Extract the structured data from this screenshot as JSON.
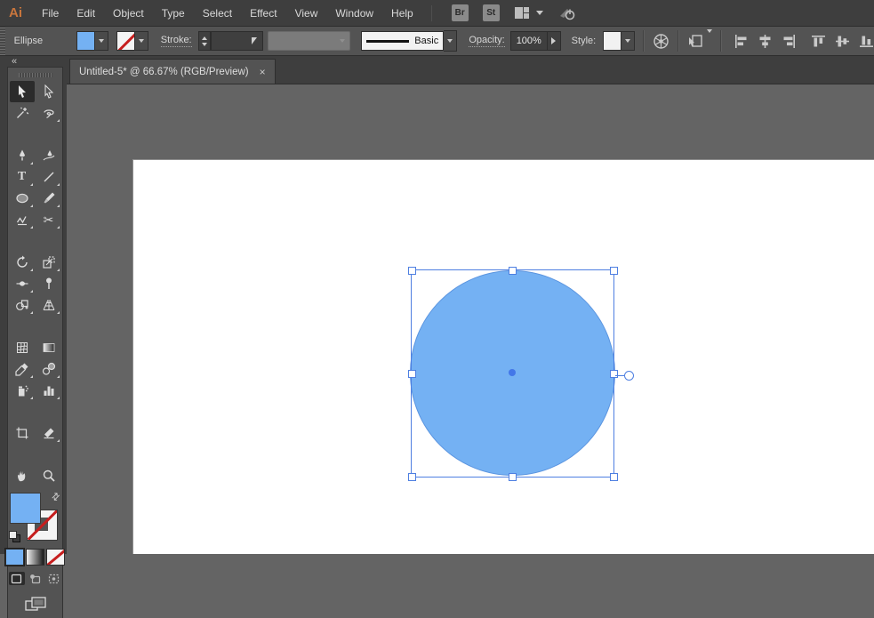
{
  "app": {
    "logo": "Ai",
    "accent_orange": "#C9763D"
  },
  "menubar": {
    "items": [
      "File",
      "Edit",
      "Object",
      "Type",
      "Select",
      "Effect",
      "View",
      "Window",
      "Help"
    ],
    "bridge_label": "Br",
    "stock_label": "St",
    "icons": [
      "workspace-switcher-icon",
      "gpu-performance-icon"
    ]
  },
  "control_bar": {
    "selection_label": "Ellipse",
    "fill_color": "#74B1F3",
    "stroke_color": "none",
    "stroke_label": "Stroke:",
    "stroke_width_value": "",
    "brush_name": "Basic",
    "opacity_label": "Opacity:",
    "opacity_value": "100%",
    "style_label": "Style:",
    "icons": [
      "recolor-artwork-icon",
      "select-similar-objects-icon",
      "align-left-icon",
      "align-horizontal-center-icon",
      "align-right-icon",
      "align-top-icon",
      "align-vertical-center-icon",
      "align-bottom-icon"
    ]
  },
  "document_tab": {
    "title": "Untitled-5* @ 66.67% (RGB/Preview)",
    "close_glyph": "×"
  },
  "toolbar": {
    "collapse_glyph": "«",
    "active_tool": "selection",
    "type_glyph": "T",
    "scissors_glyph": "✂",
    "swap_glyph": "⇄",
    "tools": [
      "selection",
      "direct-selection",
      "magic-wand",
      "lasso",
      "pen",
      "curvature",
      "type",
      "line-segment",
      "ellipse",
      "paintbrush",
      "shaper",
      "scissors",
      "rotate",
      "scale",
      "width",
      "puppet-warp",
      "shape-builder",
      "perspective-grid",
      "mesh",
      "gradient",
      "eyedropper",
      "blend",
      "symbol-sprayer",
      "column-graph",
      "artboard",
      "slice",
      "hand",
      "zoom"
    ],
    "fill_proxy_color": "#74B1F3",
    "stroke_proxy": "none",
    "appearance_buttons": [
      "color",
      "gradient",
      "none"
    ],
    "drawing_modes": [
      "draw-normal",
      "draw-behind",
      "draw-inside"
    ],
    "drawing_mode_active": "draw-normal"
  },
  "canvas": {
    "pasteboard_color": "#646464",
    "artboard_color": "#FFFFFF",
    "selection_color": "#4E7FE1",
    "shape": {
      "type": "ellipse",
      "fill": "#74B1F3",
      "selected": true,
      "handles": 8,
      "center_point": true,
      "live_shape_widget": true
    }
  }
}
